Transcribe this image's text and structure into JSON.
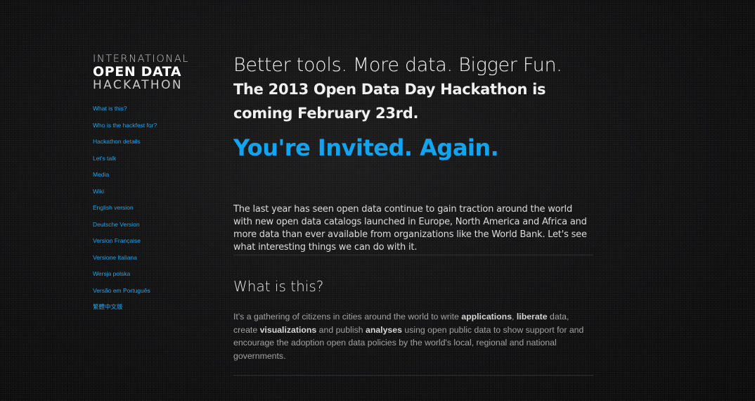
{
  "logo": {
    "line1": "INTERNATIONAL",
    "line2": "OPEN DATA",
    "line3": "HACKATHON"
  },
  "nav": [
    "What is this?",
    "Who is the hackfest for?",
    "Hackathon details",
    "Let's talk",
    "Media",
    "Wiki",
    "English version",
    "Deutsche Version",
    "Version Française",
    "Versione Italiana",
    "Wersja polska",
    "Versão em Português",
    "繁體中文版"
  ],
  "main": {
    "headline": "Better tools. More data. Bigger Fun.",
    "subheadline": "The 2013 Open Data Day Hackathon is coming February 23rd.",
    "invite": "You're Invited. Again.",
    "intro": "The last year has seen open data continue to gain traction around the world with new open data catalogs launched in Europe, North America and Africa and more data than ever available from organizations like the World Bank. Let's see what interesting things we can do with it.",
    "section_title": "What is this?",
    "body": {
      "t1": "It's a gathering of citizens in cities around the world to write ",
      "b1": "applications",
      "t2": ", ",
      "b2": "liberate",
      "t3": " data, create ",
      "b3": "visualizations",
      "t4": " and publish ",
      "b4": "analyses",
      "t5": " using open public data to show support for and encourage the adoption open data policies by the world's local, regional and national governments."
    }
  },
  "colors": {
    "accent": "#11a5ef",
    "link": "#1ea3ea",
    "background": "#141415"
  }
}
